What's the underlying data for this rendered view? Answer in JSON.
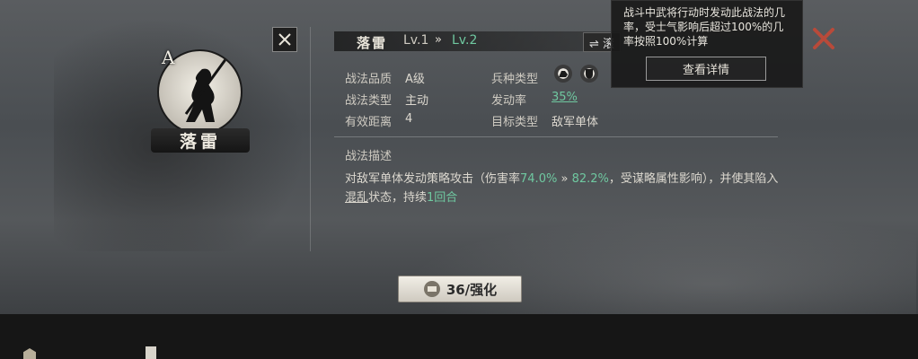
{
  "skill": {
    "name": "落雷",
    "grade_letter": "A",
    "level_current": "Lv.1",
    "level_arrow": "»",
    "level_next": "Lv.2",
    "switch_label": "⇌ 滚"
  },
  "attributes": {
    "quality_label": "战法品质",
    "quality_value": "A级",
    "type_label": "战法类型",
    "type_value": "主动",
    "range_label": "有效距离",
    "range_value": "4",
    "troop_label": "兵种类型",
    "troop_icons": [
      "cavalry-icon",
      "shield-icon"
    ],
    "rate_label": "发动率",
    "rate_value": "35%",
    "target_label": "目标类型",
    "target_value": "敌军单体"
  },
  "description": {
    "title": "战法描述",
    "part1": "对敌军单体发动策略攻击（伤害率",
    "dmg_from": "74.0%",
    "arrow": "»",
    "dmg_to": "82.2%",
    "part2": "，受谋略属性影响），并使其陷入",
    "status": "混乱",
    "part3": "状态，持续",
    "duration": "1回合"
  },
  "tooltip": {
    "text": "战斗中武将行动时发动此战法的几率，受士气影响后超过100%的几率按照100%计算",
    "details_button": "查看详情"
  },
  "enhance_button": {
    "label": "36/强化"
  },
  "colors": {
    "accent_green": "#6fc8a0",
    "close_red": "#b84a3a"
  }
}
